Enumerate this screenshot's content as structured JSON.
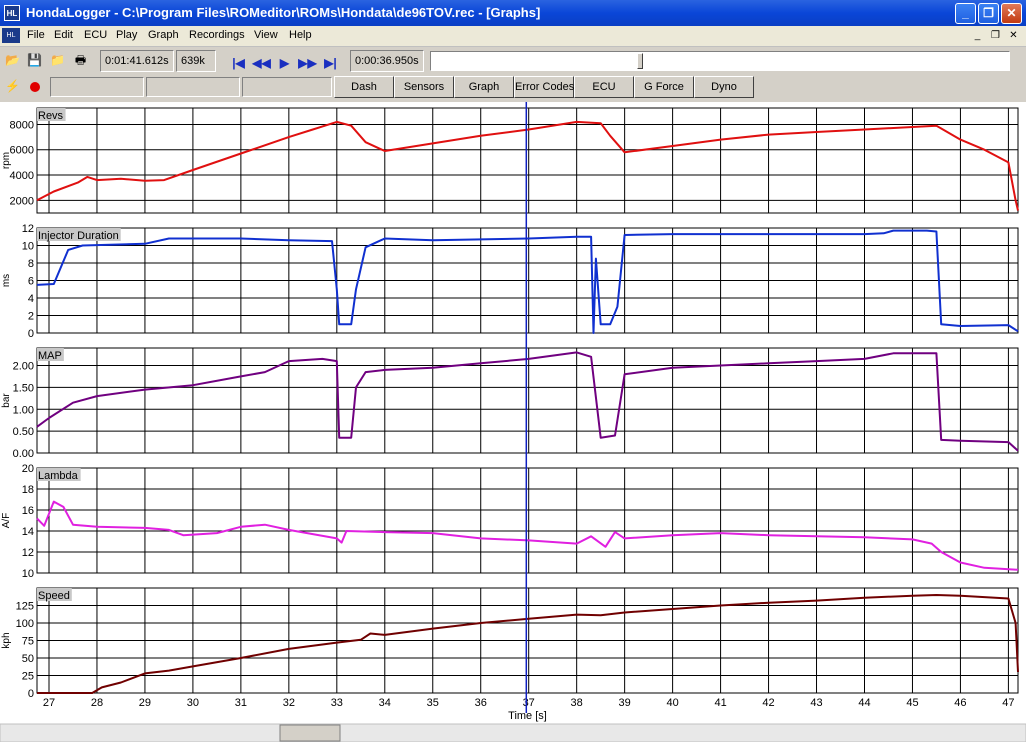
{
  "window": {
    "title": "HondaLogger - C:\\Program Files\\ROMeditor\\ROMs\\Hondata\\de96TOV.rec - [Graphs]"
  },
  "menu": [
    "File",
    "Edit",
    "ECU",
    "Play",
    "Graph",
    "Recordings",
    "View",
    "Help"
  ],
  "toolbar": {
    "elapsed": "0:01:41.612s",
    "size": "639k",
    "position": "0:00:36.950s",
    "position_fraction": 0.36
  },
  "tabs": [
    "Dash",
    "Sensors",
    "Graph",
    "Error Codes",
    "ECU",
    "G Force",
    "Dyno"
  ],
  "colors": {
    "revs": "#e01010",
    "inj": "#1030d0",
    "map": "#700080",
    "lambda": "#e020e0",
    "speed": "#700000",
    "cursor": "#1020c0"
  },
  "chart_data": {
    "type": "line",
    "xlabel": "Time [s]",
    "x_ticks": [
      "27",
      "28",
      "29",
      "30",
      "31",
      "32",
      "33",
      "34",
      "35",
      "36",
      "37",
      "38",
      "39",
      "40",
      "41",
      "42",
      "43",
      "44",
      "45",
      "46",
      "47"
    ],
    "xlim": [
      26.75,
      47.2
    ],
    "cursor_x": 36.95,
    "panels": [
      {
        "name": "Revs",
        "ylabel": "rpm",
        "ylim": [
          1000,
          9300
        ],
        "y_ticks": [
          {
            "v": 2000,
            "t": "2000"
          },
          {
            "v": 4000,
            "t": "4000"
          },
          {
            "v": 6000,
            "t": "6000"
          },
          {
            "v": 8000,
            "t": "8000"
          }
        ],
        "points": [
          [
            26.75,
            2000
          ],
          [
            27.1,
            2700
          ],
          [
            27.6,
            3400
          ],
          [
            27.8,
            3850
          ],
          [
            28,
            3600
          ],
          [
            28.5,
            3700
          ],
          [
            29,
            3550
          ],
          [
            29.4,
            3600
          ],
          [
            30,
            4400
          ],
          [
            31,
            5700
          ],
          [
            32,
            7000
          ],
          [
            32.5,
            7600
          ],
          [
            33,
            8200
          ],
          [
            33.3,
            7900
          ],
          [
            33.6,
            6600
          ],
          [
            34,
            5900
          ],
          [
            35,
            6500
          ],
          [
            36,
            7100
          ],
          [
            37,
            7600
          ],
          [
            38,
            8200
          ],
          [
            38.5,
            8100
          ],
          [
            38.7,
            7100
          ],
          [
            39,
            5800
          ],
          [
            40,
            6300
          ],
          [
            41,
            6800
          ],
          [
            42,
            7200
          ],
          [
            43,
            7400
          ],
          [
            44,
            7600
          ],
          [
            45,
            7800
          ],
          [
            45.5,
            7900
          ],
          [
            46,
            6800
          ],
          [
            46.5,
            6000
          ],
          [
            47,
            5000
          ],
          [
            47.15,
            2000
          ],
          [
            47.2,
            1200
          ]
        ]
      },
      {
        "name": "Injector Duration",
        "ylabel": "ms",
        "ylim": [
          0,
          12
        ],
        "y_ticks": [
          {
            "v": 0,
            "t": "0"
          },
          {
            "v": 2,
            "t": "2"
          },
          {
            "v": 4,
            "t": "4"
          },
          {
            "v": 6,
            "t": "6"
          },
          {
            "v": 8,
            "t": "8"
          },
          {
            "v": 10,
            "t": "10"
          },
          {
            "v": 12,
            "t": "12"
          }
        ],
        "points": [
          [
            26.75,
            5.5
          ],
          [
            27.1,
            5.6
          ],
          [
            27.4,
            9.5
          ],
          [
            27.7,
            10
          ],
          [
            29,
            10.2
          ],
          [
            29.5,
            10.8
          ],
          [
            31,
            10.8
          ],
          [
            32,
            10.6
          ],
          [
            32.9,
            10.5
          ],
          [
            33,
            5
          ],
          [
            33.05,
            1
          ],
          [
            33.3,
            1
          ],
          [
            33.4,
            5
          ],
          [
            33.6,
            9.8
          ],
          [
            34,
            10.8
          ],
          [
            35,
            10.6
          ],
          [
            36,
            10.7
          ],
          [
            37,
            10.8
          ],
          [
            38,
            11
          ],
          [
            38.3,
            11
          ],
          [
            38.35,
            0
          ],
          [
            38.4,
            8.5
          ],
          [
            38.5,
            1
          ],
          [
            38.7,
            1
          ],
          [
            38.85,
            3
          ],
          [
            39,
            11.2
          ],
          [
            40,
            11.3
          ],
          [
            42,
            11.3
          ],
          [
            44,
            11.3
          ],
          [
            44.4,
            11.4
          ],
          [
            44.6,
            11.7
          ],
          [
            45.3,
            11.7
          ],
          [
            45.5,
            11.6
          ],
          [
            45.6,
            1
          ],
          [
            46,
            0.8
          ],
          [
            47,
            0.9
          ],
          [
            47.2,
            0.2
          ]
        ]
      },
      {
        "name": "MAP",
        "ylabel": "bar",
        "ylim": [
          0,
          2.4
        ],
        "y_ticks": [
          {
            "v": 0,
            "t": "0.00"
          },
          {
            "v": 0.5,
            "t": "0.50"
          },
          {
            "v": 1,
            "t": "1.00"
          },
          {
            "v": 1.5,
            "t": "1.50"
          },
          {
            "v": 2,
            "t": "2.00"
          }
        ],
        "points": [
          [
            26.75,
            0.6
          ],
          [
            27,
            0.8
          ],
          [
            27.5,
            1.15
          ],
          [
            28,
            1.3
          ],
          [
            29,
            1.45
          ],
          [
            30,
            1.55
          ],
          [
            31,
            1.75
          ],
          [
            31.5,
            1.85
          ],
          [
            32,
            2.1
          ],
          [
            32.7,
            2.15
          ],
          [
            33,
            2.1
          ],
          [
            33.05,
            0.35
          ],
          [
            33.3,
            0.35
          ],
          [
            33.4,
            1.5
          ],
          [
            33.6,
            1.85
          ],
          [
            34,
            1.9
          ],
          [
            35,
            1.95
          ],
          [
            36,
            2.05
          ],
          [
            37,
            2.15
          ],
          [
            38,
            2.3
          ],
          [
            38.3,
            2.2
          ],
          [
            38.5,
            0.35
          ],
          [
            38.8,
            0.4
          ],
          [
            39,
            1.8
          ],
          [
            40,
            1.95
          ],
          [
            41,
            2.0
          ],
          [
            42,
            2.05
          ],
          [
            43,
            2.1
          ],
          [
            44,
            2.15
          ],
          [
            44.6,
            2.28
          ],
          [
            45.5,
            2.28
          ],
          [
            45.6,
            0.3
          ],
          [
            46,
            0.28
          ],
          [
            47,
            0.25
          ],
          [
            47.2,
            0.05
          ]
        ]
      },
      {
        "name": "Lambda",
        "ylabel": "A/F",
        "ylim": [
          10,
          20
        ],
        "y_ticks": [
          {
            "v": 10,
            "t": "10"
          },
          {
            "v": 12,
            "t": "12"
          },
          {
            "v": 14,
            "t": "14"
          },
          {
            "v": 16,
            "t": "16"
          },
          {
            "v": 18,
            "t": "18"
          },
          {
            "v": 20,
            "t": "20"
          }
        ],
        "points": [
          [
            26.75,
            15.2
          ],
          [
            26.9,
            14.5
          ],
          [
            27.1,
            16.8
          ],
          [
            27.3,
            16.3
          ],
          [
            27.5,
            14.6
          ],
          [
            28,
            14.4
          ],
          [
            29,
            14.3
          ],
          [
            29.5,
            14.1
          ],
          [
            29.8,
            13.6
          ],
          [
            30.5,
            13.8
          ],
          [
            31,
            14.4
          ],
          [
            31.5,
            14.6
          ],
          [
            32,
            14.1
          ],
          [
            33,
            13.3
          ],
          [
            33.1,
            12.9
          ],
          [
            33.2,
            14
          ],
          [
            34,
            13.9
          ],
          [
            35,
            13.8
          ],
          [
            36,
            13.3
          ],
          [
            37,
            13.1
          ],
          [
            38,
            12.8
          ],
          [
            38.3,
            13.5
          ],
          [
            38.6,
            12.5
          ],
          [
            38.8,
            13.9
          ],
          [
            39,
            13.3
          ],
          [
            40,
            13.6
          ],
          [
            41,
            13.8
          ],
          [
            42,
            13.6
          ],
          [
            43,
            13.5
          ],
          [
            44,
            13.4
          ],
          [
            45,
            13.2
          ],
          [
            45.4,
            12.8
          ],
          [
            45.6,
            12
          ],
          [
            46,
            11
          ],
          [
            46.5,
            10.5
          ],
          [
            47.2,
            10.3
          ]
        ]
      },
      {
        "name": "Speed",
        "ylabel": "kph",
        "ylim": [
          0,
          150
        ],
        "y_ticks": [
          {
            "v": 0,
            "t": "0"
          },
          {
            "v": 25,
            "t": "25"
          },
          {
            "v": 50,
            "t": "50"
          },
          {
            "v": 75,
            "t": "75"
          },
          {
            "v": 100,
            "t": "100"
          },
          {
            "v": 125,
            "t": "125"
          }
        ],
        "points": [
          [
            26.75,
            0
          ],
          [
            27.9,
            0
          ],
          [
            28.1,
            8
          ],
          [
            28.5,
            15
          ],
          [
            29,
            28
          ],
          [
            29.5,
            32
          ],
          [
            30,
            38
          ],
          [
            31,
            50
          ],
          [
            32,
            63
          ],
          [
            33,
            72
          ],
          [
            33.5,
            76
          ],
          [
            33.7,
            85
          ],
          [
            34,
            83
          ],
          [
            35,
            92
          ],
          [
            36,
            100
          ],
          [
            37,
            106
          ],
          [
            38,
            112
          ],
          [
            38.5,
            111
          ],
          [
            39,
            115
          ],
          [
            40,
            120
          ],
          [
            41,
            125
          ],
          [
            42,
            129
          ],
          [
            43,
            132
          ],
          [
            44,
            136
          ],
          [
            45,
            139
          ],
          [
            45.5,
            140
          ],
          [
            46,
            139
          ],
          [
            46.5,
            137
          ],
          [
            47,
            135
          ],
          [
            47.15,
            100
          ],
          [
            47.2,
            30
          ]
        ]
      }
    ]
  }
}
